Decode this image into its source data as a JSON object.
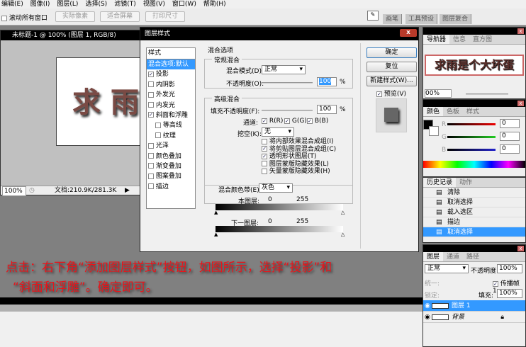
{
  "menu": [
    "编辑(E)",
    "图像(I)",
    "图层(L)",
    "选择(S)",
    "滤镜(T)",
    "视图(V)",
    "窗口(W)",
    "帮助(H)"
  ],
  "options": {
    "scroll_all": "滚动所有窗口",
    "actual_pixels": "实际像素",
    "fit_screen": "适合屏幕",
    "print_size": "打印尺寸"
  },
  "dock_tabs": [
    "画笔",
    "工具预设",
    "图层复合"
  ],
  "document": {
    "title": "未标题-1 @ 100% (图层 1, RGB/8)",
    "zoom": "100%",
    "doc_info": "文档:210.9K/281.3K",
    "canvas_chars": [
      "求",
      "雨"
    ]
  },
  "dialog": {
    "title": "图层样式",
    "close": "x",
    "styles_header": "样式",
    "styles": [
      {
        "label": "混合选项:默认",
        "checked": null,
        "selected": true
      },
      {
        "label": "投影",
        "checked": true
      },
      {
        "label": "内阴影",
        "checked": false
      },
      {
        "label": "外发光",
        "checked": false
      },
      {
        "label": "内发光",
        "checked": false
      },
      {
        "label": "斜面和浮雕",
        "checked": true
      },
      {
        "label": "等高线",
        "checked": false,
        "sub": true
      },
      {
        "label": "纹理",
        "checked": false,
        "sub": true
      },
      {
        "label": "光泽",
        "checked": false
      },
      {
        "label": "颜色叠加",
        "checked": false
      },
      {
        "label": "渐变叠加",
        "checked": false
      },
      {
        "label": "图案叠加",
        "checked": false
      },
      {
        "label": "描边",
        "checked": false
      }
    ],
    "blend_options": "混合选项",
    "general": {
      "title": "常规混合",
      "mode_label": "混合模式(D):",
      "mode": "正常",
      "opacity_label": "不透明度(O):",
      "opacity": "100",
      "pct": "%"
    },
    "advanced": {
      "title": "高级混合",
      "fill_label": "填充不透明度(F):",
      "fill": "100",
      "pct": "%",
      "channels_label": "通道:",
      "r": "R(R)",
      "g": "G(G)",
      "b": "B(B)",
      "knockout_label": "挖空(K):",
      "knockout": "无",
      "options": [
        {
          "label": "将内部效果混合成组(I)",
          "checked": false
        },
        {
          "label": "将剪贴图层混合成组(C)",
          "checked": true
        },
        {
          "label": "透明形状图层(T)",
          "checked": true
        },
        {
          "label": "图层蒙版隐藏效果(L)",
          "checked": false
        },
        {
          "label": "矢量蒙版隐藏效果(H)",
          "checked": false
        }
      ]
    },
    "blend_if": {
      "label": "混合颜色带(E):",
      "value": "灰色",
      "this_layer": "本图层:",
      "underlying": "下一图层:",
      "min": "0",
      "max": "255"
    },
    "buttons": {
      "ok": "确定",
      "reset": "复位",
      "new_style": "新建样式(W)...",
      "preview": "预览(V)"
    }
  },
  "instruction": [
    "点击：右下角“添加图层样式”按钮，如图所示，选择“投影”和",
    "“斜面和浮雕”。确定即可。"
  ],
  "navigator": {
    "tabs": [
      "导航器",
      "信息",
      "直方图"
    ],
    "thumb_text": "求雨是个大坏蛋",
    "zoom": "00%"
  },
  "color": {
    "tabs": [
      "颜色",
      "色板",
      "样式"
    ],
    "r_label": "R",
    "g_label": "G",
    "b_label": "B",
    "r": "0",
    "g": "0",
    "b": "0"
  },
  "history": {
    "tabs": [
      "历史记录",
      "动作"
    ],
    "items": [
      "清除",
      "取消选择",
      "载入选区",
      "描边",
      "取消选择"
    ]
  },
  "layers": {
    "tabs": [
      "图层",
      "通道",
      "路径"
    ],
    "mode": "正常",
    "opacity_label": "不透明度:",
    "opacity": "100%",
    "unify_label": "统一:",
    "propagate": "传播帧 1",
    "lock_label": "锁定:",
    "fill_label": "填充:",
    "fill": "100%",
    "rows": [
      {
        "name": "图层 1",
        "selected": true
      },
      {
        "name": "背景",
        "selected": false
      }
    ]
  },
  "colors": {
    "accent": "#3399ff",
    "instruction": "#e8141a"
  }
}
